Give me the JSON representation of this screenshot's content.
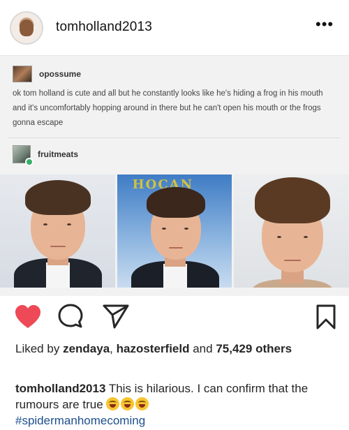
{
  "post": {
    "username": "tomholland2013",
    "more_icon": "•••"
  },
  "tumblr": {
    "post1": {
      "username": "opossume",
      "text": "ok tom holland is cute and all but he constantly looks like he's hiding a frog in his mouth and it's uncomfortably hopping around in there but he can't open his mouth or the frogs gonna escape"
    },
    "post2": {
      "username": "fruitmeats"
    },
    "banner_text": "HOCAN"
  },
  "actions": {
    "like_icon": "heart-icon",
    "comment_icon": "comment-icon",
    "share_icon": "send-icon",
    "save_icon": "bookmark-icon"
  },
  "likes": {
    "prefix": "Liked by",
    "user1": "zendaya",
    "separator": ",",
    "user2": "hazosterfield",
    "and_text": "and",
    "count": "75,429",
    "suffix": "others"
  },
  "caption": {
    "username": "tomholland2013",
    "text": "This is hilarious. I can confirm that the rumours are true",
    "emoji_count": 3,
    "hashtag": "#spidermanhomecoming"
  },
  "colors": {
    "like_red": "#ed4956",
    "hashtag_blue": "#1e4e8c",
    "tumblr_bg": "#f2f2f2"
  }
}
